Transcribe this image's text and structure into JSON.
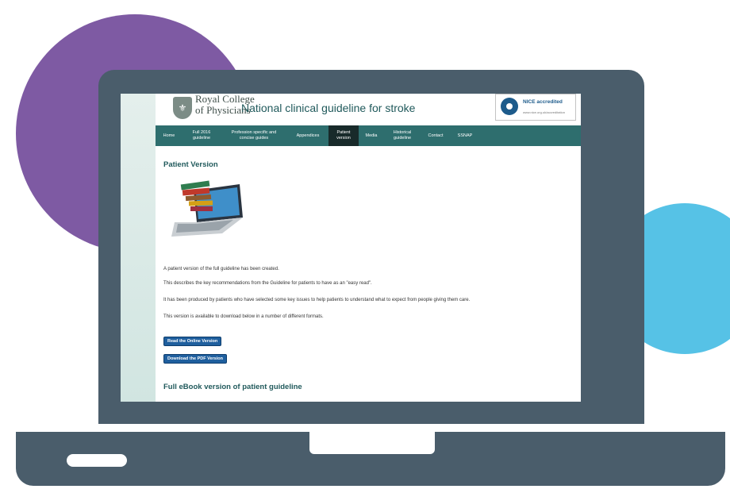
{
  "header": {
    "org_line1": "Royal College",
    "org_line2": "of Physicians",
    "site_title": "National clinical guideline for stroke",
    "badge_text": "NICE accredited",
    "badge_sub": "www.nice.org.uk/accreditation"
  },
  "nav": {
    "items": [
      {
        "label": "Home"
      },
      {
        "label": "Full 2016 guideline"
      },
      {
        "label": "Profession specific and concise guides"
      },
      {
        "label": "Appendices"
      },
      {
        "label": "Patient version"
      },
      {
        "label": "Media"
      },
      {
        "label": "Historical guideline"
      },
      {
        "label": "Contact"
      },
      {
        "label": "SSNAP"
      }
    ],
    "active_index": 4
  },
  "main": {
    "heading": "Patient Version",
    "image_icon": "laptop-with-books-icon",
    "para1": "A patient version of the full guideline has been created.",
    "para2": "This describes the key recommendations from the Guideline for patients to have as an \"easy read\".",
    "para3": "It has been produced by patients who have selected some key issues to help patients to understand what to expect from people giving them care.",
    "para4": "This version is available to download below in a number of different formats.",
    "btn_online": "Read the Online Version",
    "btn_pdf": "Download the PDF Version",
    "ebook_heading": "Full eBook version of patient guideline"
  },
  "colors": {
    "nav_bg": "#2e6e6e",
    "nav_active": "#182a2a",
    "heading": "#215a5c",
    "button": "#1f5f9e",
    "device": "#4a5d6b",
    "purple_circle": "#7e5aa3",
    "blue_circle": "#56c2e6"
  }
}
